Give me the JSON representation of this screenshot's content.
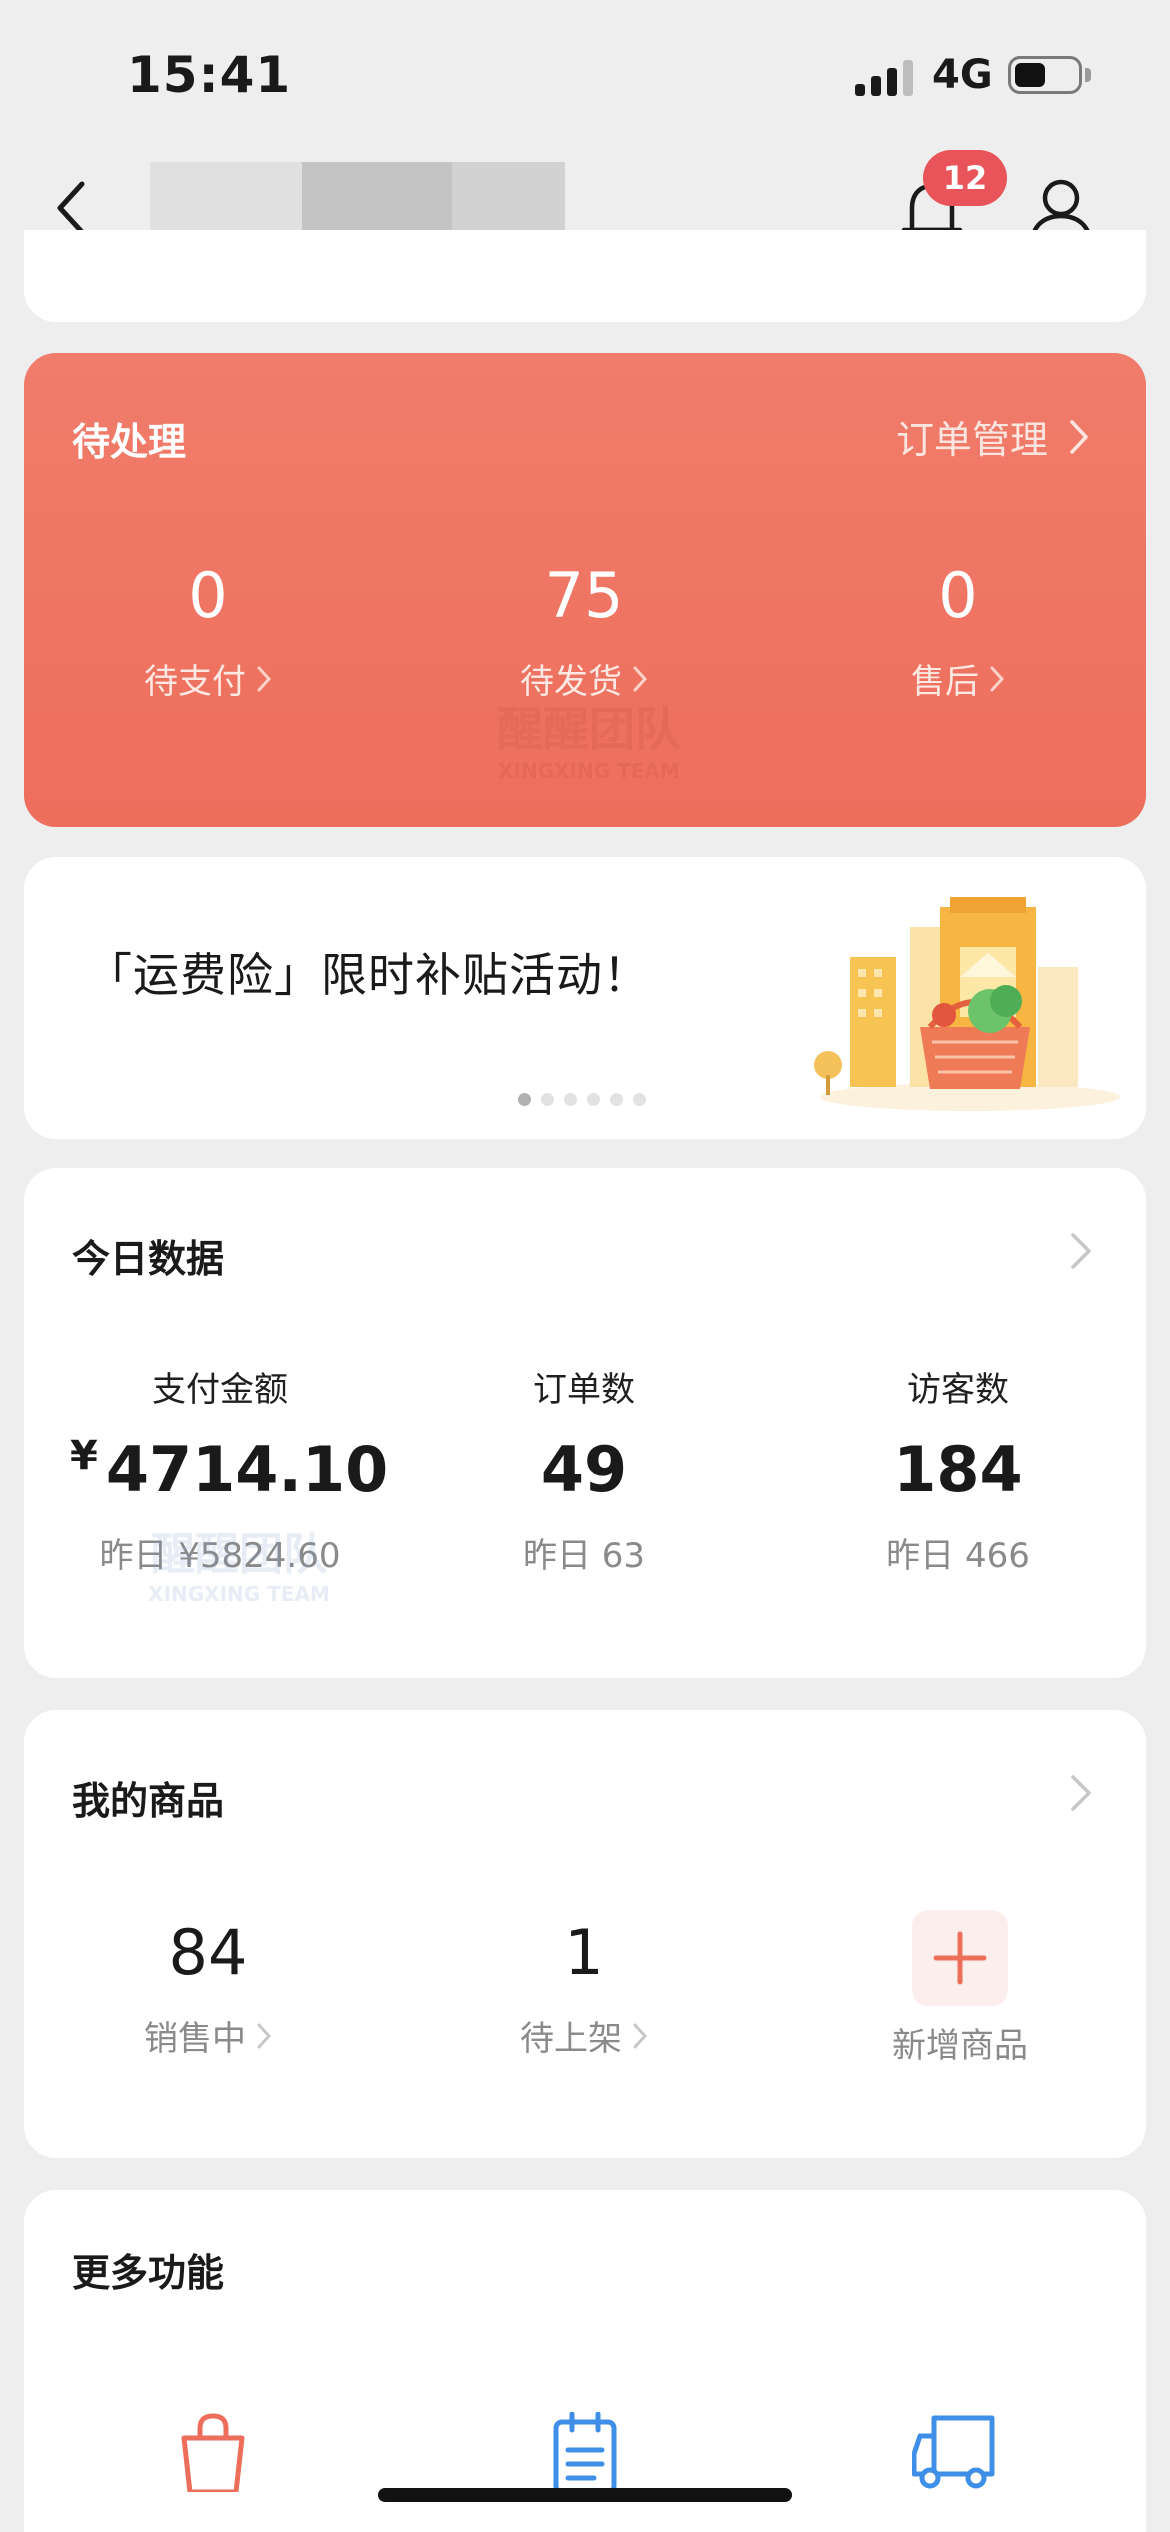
{
  "status_bar": {
    "time": "15:41",
    "network": "4G"
  },
  "nav": {
    "notification_count": "12",
    "icons": [
      "back-icon",
      "bell-icon",
      "user-icon"
    ]
  },
  "pending": {
    "title": "待处理",
    "order_link": "订单管理",
    "items": [
      {
        "value": "0",
        "label": "待支付"
      },
      {
        "value": "75",
        "label": "待发货"
      },
      {
        "value": "0",
        "label": "售后"
      }
    ]
  },
  "watermark": {
    "text": "醒醒团队",
    "sub": "XINGXING TEAM"
  },
  "banner": {
    "text": "「运费险」限时补贴活动！",
    "page_count": 6,
    "active_page": 1
  },
  "today": {
    "title": "今日数据",
    "items": [
      {
        "caption": "支付金额",
        "currency": "¥",
        "value": "4714.10",
        "yesterday": "昨日 ¥5824.60"
      },
      {
        "caption": "订单数",
        "value": "49",
        "yesterday": "昨日 63"
      },
      {
        "caption": "访客数",
        "value": "184",
        "yesterday": "昨日 466"
      }
    ]
  },
  "goods": {
    "title": "我的商品",
    "items": [
      {
        "value": "84",
        "label": "销售中"
      },
      {
        "value": "1",
        "label": "待上架"
      }
    ],
    "add_label": "新增商品"
  },
  "more": {
    "title": "更多功能",
    "icons": [
      "shopping-bag-icon",
      "notepad-icon",
      "delivery-truck-icon"
    ]
  },
  "colors": {
    "accent": "#ee6e5c",
    "badge": "#e8545a",
    "blue_icon": "#3f8ee8"
  }
}
